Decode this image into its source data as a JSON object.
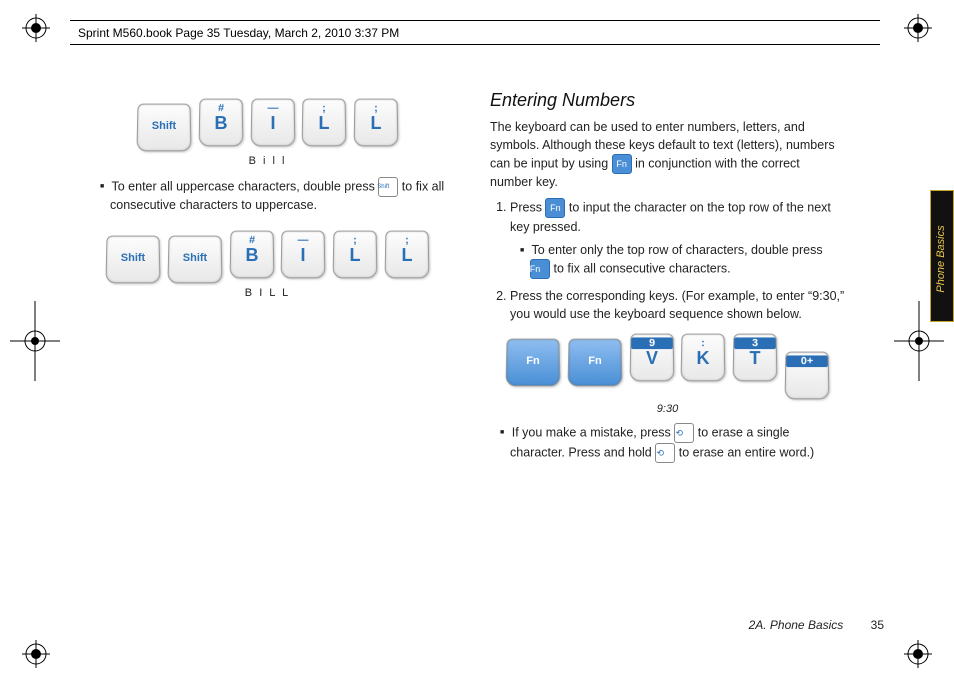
{
  "header": {
    "text": "Sprint M560.book  Page 35  Tuesday, March 2, 2010  3:37 PM"
  },
  "left_col": {
    "row1_caption": "B  i   l   l",
    "bullet1_a": "To enter all uppercase characters, double press",
    "bullet1_b": " to fix all consecutive characters to uppercase.",
    "row2_caption": "B I L L"
  },
  "right_col": {
    "heading": "Entering Numbers",
    "intro_a": "The keyboard can be used to enter numbers, letters, and symbols. Although these keys default to text (letters), numbers can be input by using ",
    "intro_b": " in conjunction with the correct number key.",
    "step1_a": "Press ",
    "step1_b": " to input the character on the top row of the next key pressed.",
    "sub_bullet_a": "To enter only the top row of characters, double press ",
    "sub_bullet_b": " to fix all consecutive characters.",
    "step2": "Press the corresponding keys. (For example, to enter “9:30,” you would use the keyboard sequence shown below.",
    "caption_930": "9:30",
    "bullet2_a": "If you make a mistake, press ",
    "bullet2_b": " to erase a single character. Press and hold ",
    "bullet2_c": " to erase an entire word.)"
  },
  "keys": {
    "shift": "Shift",
    "fn": "Fn",
    "b_top": "#",
    "b_bot": "B",
    "i_top": "—",
    "i_bot": "I",
    "l_top": ";",
    "l_bot": "L",
    "v_top": "9",
    "v_bot": "V",
    "k_top": ":",
    "k_bot": "K",
    "t_top": "3",
    "t_bot": "T",
    "zero_top": "0+",
    "zero_bot": ""
  },
  "side_tab": "Phone Basics",
  "footer": {
    "section": "2A. Phone Basics",
    "page": "35"
  }
}
